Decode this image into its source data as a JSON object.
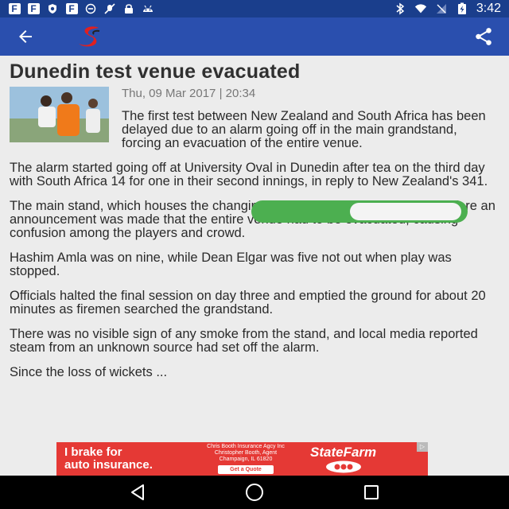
{
  "status_bar": {
    "time": "3:42",
    "left_icons": [
      "flipboard-icon",
      "flipboard-icon",
      "shield-icon",
      "flipboard-icon",
      "circle-dash-icon",
      "no-mic-icon",
      "lock-icon",
      "android-icon"
    ],
    "right_icons": [
      "bluetooth-icon",
      "wifi-icon",
      "no-signal-icon",
      "battery-charging-icon"
    ]
  },
  "app_bar": {
    "back_icon": "arrow-back-icon",
    "logo": "supersport-logo",
    "share_icon": "share-icon",
    "color": "#2a4fae"
  },
  "article": {
    "headline": "Dunedin test venue evacuated",
    "dateline": "Thu, 09 Mar 2017 | 20:34",
    "intro": "The first test between New Zealand and South Africa has been delayed due to an alarm going off in the main grandstand, forcing an evacuation of the entire venue.",
    "paragraphs": [
      "The alarm started going off at University Oval in Dunedin after tea on the third day with South Africa 14 for one in their second innings, in reply to New Zealand's 341.",
      "The main stand, which houses the changing rooms, was being evacuated before an announcement was made that the entire venue had to be evacuated, causing confusion among the players and crowd.",
      "Hashim Amla was on nine, while Dean Elgar was five not out when play was stopped.",
      "Officials halted the final session on day three and emptied the ground for about 20 minutes as firemen searched the grandstand.",
      "There was no visible sign of any smoke from the stand, and local media reported steam from an unknown source had set off the alarm.",
      "Since the loss of wickets ..."
    ]
  },
  "ad": {
    "headline_line1": "I brake for",
    "headline_line2": "auto insurance.",
    "agency_name": "Chris Booth Insurance Agcy Inc",
    "agent_line": "Christopher Booth, Agent",
    "location": "Champaign, IL 61820",
    "cta": "Get a Quote",
    "brand": "StateFarm",
    "color": "#e53935"
  },
  "nav_bar": {
    "back_icon": "nav-back-icon",
    "home_icon": "nav-home-icon",
    "recents_icon": "nav-recents-icon"
  }
}
